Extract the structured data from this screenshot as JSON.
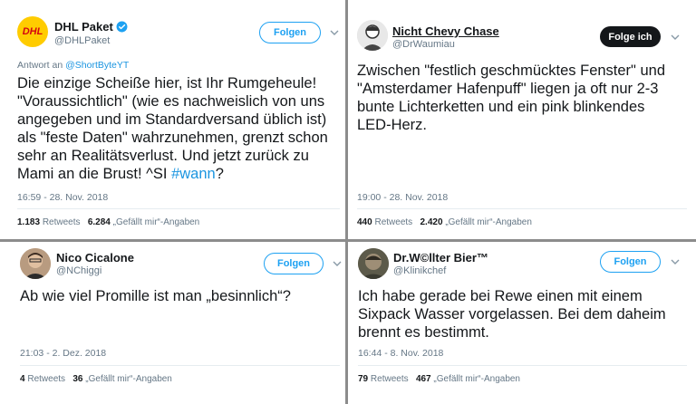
{
  "tweets": [
    {
      "name": "DHL Paket",
      "handle": "@DHLPaket",
      "verified": true,
      "follow_label": "Folgen",
      "reply_prefix": "Antwort an",
      "reply_to": "@ShortByteYT",
      "text": "Die einzige Scheiße hier, ist Ihr Rumgeheule! \"Voraussichtlich\" (wie es nachweislich von uns angegeben und im Standardversand üblich ist) als \"feste Daten\" wahrzunehmen, grenzt schon sehr an Realitätsverlust. Und jetzt zurück zu Mami an die Brust! ^SI ",
      "hashtag": "#wann",
      "text_end": "?",
      "time": "16:59 - 28. Nov. 2018",
      "retweets": "1.183",
      "retweets_label": "Retweets",
      "likes": "6.284",
      "likes_label": "„Gefällt mir“-Angaben"
    },
    {
      "name": "Nicht Chevy Chase",
      "handle": "@DrWaumiau",
      "follow_label": "Folge ich",
      "text": "Zwischen \"festlich geschmücktes Fenster\" und \"Amsterdamer Hafenpuff\" liegen ja oft nur 2-3 bunte Lichterketten und ein pink blinkendes LED-Herz.",
      "time": "19:00 - 28. Nov. 2018",
      "retweets": "440",
      "retweets_label": "Retweets",
      "likes": "2.420",
      "likes_label": "„Gefällt mir“-Angaben"
    },
    {
      "name": "Nico Cicalone",
      "handle": "@NChiggi",
      "follow_label": "Folgen",
      "text": "Ab wie viel Promille ist man „besinnlich“?",
      "time": "21:03 - 2. Dez. 2018",
      "retweets": "4",
      "retweets_label": "Retweets",
      "likes": "36",
      "likes_label": "„Gefällt mir“-Angaben"
    },
    {
      "name": "Dr.W©llter Bier™",
      "handle": "@Klinikchef",
      "follow_label": "Folgen",
      "text": "Ich habe gerade bei Rewe einen mit einem Sixpack Wasser vorgelassen. Bei dem daheim brennt es bestimmt.",
      "time": "16:44 - 8. Nov. 2018",
      "retweets": "79",
      "retweets_label": "Retweets",
      "likes": "467",
      "likes_label": "„Gefällt mir“-Angaben"
    }
  ],
  "avatars": {
    "dhl": {
      "logo_text": "DHL",
      "bg": "#ffcc00",
      "fg": "#d40511"
    }
  },
  "colors": {
    "link": "#1b95e0",
    "follow": "#1da1f2",
    "divider": "#8c8c8c"
  }
}
